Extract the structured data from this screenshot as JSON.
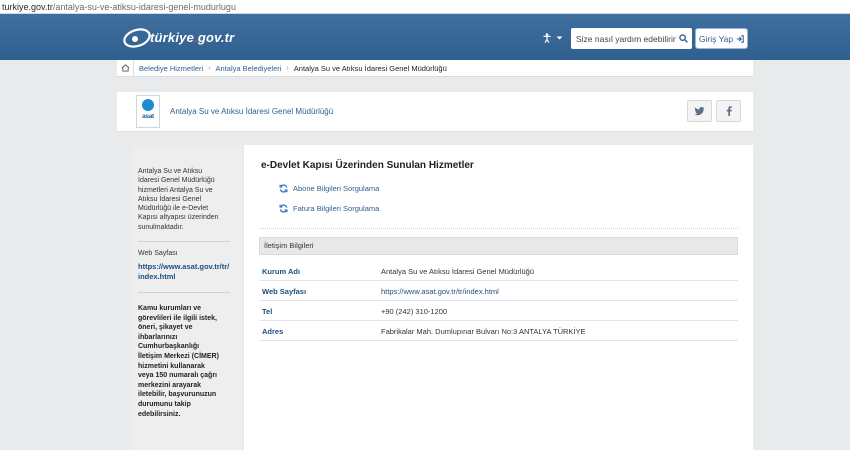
{
  "browser": {
    "url_host": "turkiye.gov.tr",
    "url_path": "/antalya-su-ve-atiksu-idaresi-genel-mudurlugu"
  },
  "header": {
    "logo_text_main": "türkiye",
    "logo_text_dot": ".",
    "logo_text_tail": "gov.tr",
    "search_placeholder": "Size nasıl yardım edebilirim?",
    "login_label": "Giriş Yap",
    "accent_color": "#2f5f8f"
  },
  "breadcrumb": {
    "items": [
      {
        "label": "Belediye Hizmetleri"
      },
      {
        "label": "Antalya Belediyeleri"
      },
      {
        "label": "Antalya Su ve Atıksu İdaresi Genel Müdürlüğü"
      }
    ]
  },
  "institution": {
    "logo_word": "asat",
    "title": "Antalya Su ve Atıksu İdaresi Genel Müdürlüğü"
  },
  "sidebar": {
    "description": "Antalya Su ve Atıksu İdaresi Genel Müdürlüğü hizmetleri Antalya Su ve Atıksu İdaresi Genel Müdürlüğü ile e-Devlet Kapısı altyapısı üzerinden sunulmaktadır.",
    "web_label": "Web Sayfası",
    "web_link": "https://www.asat.gov.tr/tr/index.html",
    "cimer_text": "Kamu kurumları ve görevlileri ile ilgili istek, öneri, şikayet ve ihbarlarınızı Cumhurbaşkanlığı İletişim Merkezi (CİMER) hizmetini kullanarak veya 150 numaralı çağrı merkezini arayarak iletebilir, başvurunuzun durumunu takip edebilirsiniz."
  },
  "services": {
    "title": "e-Devlet Kapısı Üzerinden Sunulan Hizmetler",
    "items": [
      {
        "label": "Abone Bilgileri Sorgulama"
      },
      {
        "label": "Fatura Bilgileri Sorgulama"
      }
    ]
  },
  "contact": {
    "heading": "İletişim Bilgileri",
    "rows": [
      {
        "key": "Kurum Adı",
        "value": "Antalya Su ve Atıksu İdaresi Genel Müdürlüğü"
      },
      {
        "key": "Web Sayfası",
        "value": "https://www.asat.gov.tr/tr/index.html"
      },
      {
        "key": "Tel",
        "value": "+90 (242) 310-1200"
      },
      {
        "key": "Adres",
        "value": "Fabrikalar Mah. Dumlupınar Bulvarı No:3 ANTALYA TÜRKİYE"
      }
    ]
  }
}
